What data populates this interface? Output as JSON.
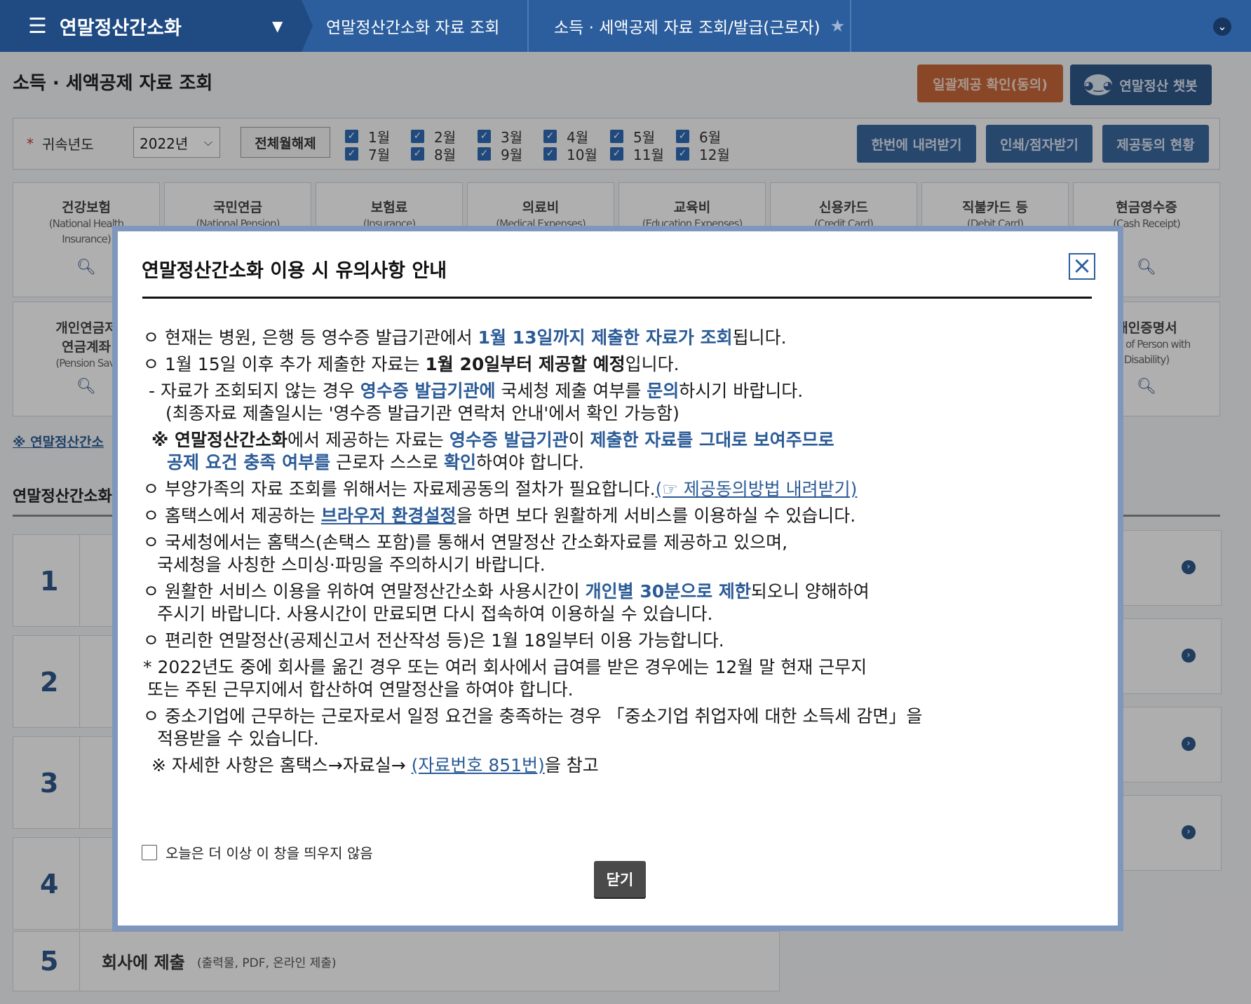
{
  "topnav": {
    "menu_icon": "hamburger-icon",
    "home_label": "연말정산간소화",
    "crumb1": "연말정산간소화 자료 조회",
    "crumb2": "소득 · 세액공제 자료 조회/발급(근로자)"
  },
  "page": {
    "title": "소득 · 세액공제 자료 조회",
    "btn_consent": "일괄제공 확인(동의)",
    "btn_chatbot": "연말정산 챗봇"
  },
  "filter": {
    "year_label": "귀속년도",
    "year_value": "2022년",
    "clear_all": "전체월해제",
    "months": [
      "1월",
      "2월",
      "3월",
      "4월",
      "5월",
      "6월",
      "7월",
      "8월",
      "9월",
      "10월",
      "11월",
      "12월"
    ],
    "btn_download_all": "한번에 내려받기",
    "btn_print": "인쇄/점자받기",
    "btn_consent_status": "제공동의 현황"
  },
  "tiles": [
    {
      "kr": "건강보험",
      "en1": "(National Health",
      "en2": "Insurance)"
    },
    {
      "kr": "국민연금",
      "en1": "(National Pension)",
      "en2": ""
    },
    {
      "kr": "보험료",
      "en1": "(Insurance)",
      "en2": ""
    },
    {
      "kr": "의료비",
      "en1": "(Medical Expenses)",
      "en2": ""
    },
    {
      "kr": "교육비",
      "en1": "(Education Expenses)",
      "en2": ""
    },
    {
      "kr": "신용카드",
      "en1": "(Credit Card)",
      "en2": ""
    },
    {
      "kr": "직불카드 등",
      "en1": "(Debit Card)",
      "en2": ""
    },
    {
      "kr": "현금영수증",
      "en1": "(Cash Receipt)",
      "en2": ""
    }
  ],
  "tiles_row2": {
    "left_kr1": "개인연금저",
    "left_kr2": "연금계좌",
    "left_en": "(Pension Savi",
    "right_kr": "애인증명서",
    "right_en1": "cate of Person with",
    "right_en2": "Disability)"
  },
  "under": {
    "link": "※ 연말정산간소",
    "section": "연말정산간소화",
    "steps": [
      {
        "num": "1",
        "text": ""
      },
      {
        "num": "2",
        "text": ""
      },
      {
        "num": "3",
        "text": ""
      },
      {
        "num": "4",
        "text": ""
      },
      {
        "num": "5",
        "text": "회사에 제출",
        "sub": "(출력물, PDF, 온라인 제출)"
      }
    ]
  },
  "modal": {
    "title": "연말정산간소화 이용 시 유의사항 안내",
    "l1a": "ㅇ 현재는 병원, 은행 등 영수증 발급기관에서 ",
    "l1b": "1월 13일까지 제출한 자료가 조회",
    "l1c": "됩니다.",
    "l2a": "ㅇ 1월 15일 이후 추가 제출한 자료는 ",
    "l2b": "1월 20일부터 제공할 예정",
    "l2c": "입니다.",
    "l3a": " - 자료가 조회되지 않는 경우 ",
    "l3b": "영수증 발급기관에",
    "l3c": " 국세청 제출 여부를 ",
    "l3d": "문의",
    "l3e": "하시기 바랍니다.",
    "l4": "(최종자료 제출일시는 '영수증 발급기관 연락처 안내'에서 확인 가능함)",
    "l5a": "※ ",
    "l5b": "연말정산간소화",
    "l5c": "에서 제공하는 자료는 ",
    "l5d": "영수증 발급기관",
    "l5e": "이 ",
    "l5f": "제출한 자료를 그대로 보여주므로",
    "l6a": "공제 요건 충족 여부를",
    "l6b": " 근로자 스스로 ",
    "l6c": "확인",
    "l6d": "하여야 합니다.",
    "l7a": "ㅇ 부양가족의 자료 조회를 위해서는 자료제공동의 절차가 필요합니다.",
    "l7b": "(☞ 제공동의방법 내려받기)",
    "l8a": "ㅇ 홈택스에서 제공하는 ",
    "l8b": "브라우저 환경설정",
    "l8c": "을 하면 보다 원활하게 서비스를 이용하실 수 있습니다.",
    "l9": "ㅇ 국세청에서는 홈택스(손택스 포함)를 통해서 연말정산 간소화자료를 제공하고 있으며,",
    "l10": "국세청을 사칭한 스미싱·파밍을 주의하시기 바랍니다.",
    "l11a": "ㅇ 원활한 서비스 이용을 위하여 연말정산간소화 사용시간이 ",
    "l11b": "개인별 30분으로 제한",
    "l11c": "되오니 양해하여",
    "l12": "주시기 바랍니다. 사용시간이 만료되면 다시 접속하여 이용하실 수 있습니다.",
    "l13": "ㅇ 편리한 연말정산(공제신고서 전산작성 등)은 1월 18일부터 이용 가능합니다.",
    "l14": "* 2022년도 중에 회사를 옮긴 경우 또는 여러 회사에서 급여를 받은 경우에는 12월 말 현재 근무지",
    "l15": "또는 주된 근무지에서 합산하여 연말정산을 하여야 합니다.",
    "l16": "ㅇ 중소기업에 근무하는 근로자로서 일정 요건을 충족하는 경우 「중소기업 취업자에 대한 소득세 감면」을",
    "l17": "적용받을 수 있습니다.",
    "l18a": "※ 자세한 사항은 홈택스→자료실→ ",
    "l18b": "(자료번호 851번)",
    "l18c": "을 참고",
    "dont_show": "오늘은 더 이상 이 창을 띄우지 않음",
    "close_btn": "닫기"
  },
  "colors": {
    "nav_blue": "#2c5e9e",
    "highlight_blue": "#2b5b97",
    "orange": "#c4663a"
  }
}
